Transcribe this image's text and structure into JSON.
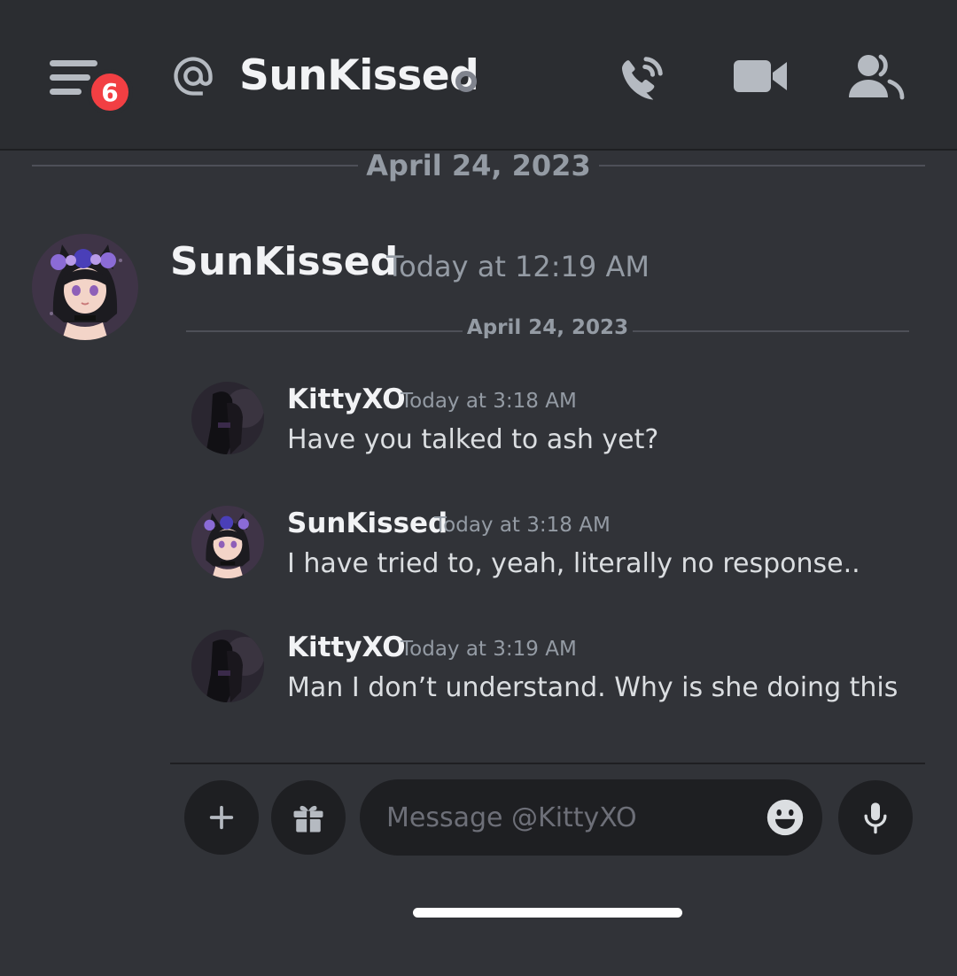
{
  "header": {
    "title": "SunKissed",
    "menu_badge_count": "6",
    "icons": [
      "menu-icon",
      "at-icon",
      "status-offline-icon",
      "phone-call-icon",
      "video-camera-icon",
      "members-icon"
    ]
  },
  "date_divider_top": "April 24, 2023",
  "outer_message": {
    "author": "SunKissed",
    "timestamp": "Today at 12:19 AM"
  },
  "embed": {
    "date_divider": "April 24, 2023",
    "messages": [
      {
        "author": "KittyXO",
        "timestamp": "Today at 3:18 AM",
        "text": "Have you talked to ash yet?"
      },
      {
        "author": "SunKissed",
        "timestamp": "Today at 3:18 AM",
        "text": "I have tried to, yeah, literally no response.."
      },
      {
        "author": "KittyXO",
        "timestamp": "Today at 3:19 AM",
        "text": "Man I don’t understand. Why is she doing this"
      }
    ]
  },
  "composer": {
    "placeholder": "Message @KittyXO",
    "icons": [
      "plus-icon",
      "gift-icon",
      "emoji-icon",
      "microphone-icon"
    ]
  },
  "colors": {
    "background": "#313338",
    "header": "#2b2d31",
    "input": "#1e1f22",
    "badge": "#f23f43",
    "muted_text": "#949ba4",
    "icon": "#b5bac1"
  }
}
